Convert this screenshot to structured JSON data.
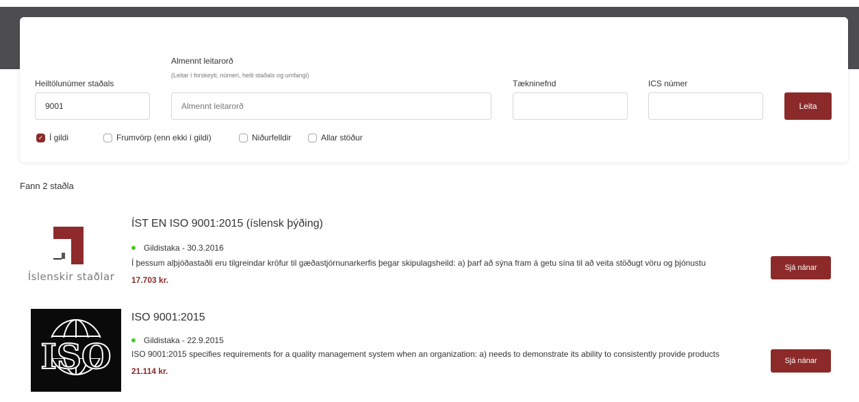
{
  "search": {
    "fields": {
      "number_label": "Heiltölunúmer staðals",
      "number_value": "9001",
      "general_label": "Almennt leitarorð",
      "general_hint": "(Leitar í forskeyti, númeri, heiti staðals og umfangi)",
      "general_placeholder": "Almennt leitarorð",
      "committee_label": "Tækninefnd",
      "committee_value": "",
      "ics_label": "ICS númer",
      "ics_value": ""
    },
    "button_label": "Leita",
    "status_filters": [
      {
        "label": "Í gildi",
        "checked": true
      },
      {
        "label": "Frumvörp (enn ekki í gildi)",
        "checked": false
      },
      {
        "label": "Niðurfelldir",
        "checked": false
      },
      {
        "label": "Allar stöður",
        "checked": false
      }
    ]
  },
  "results": {
    "count_text": "Fann 2 staðla",
    "items": [
      {
        "logo": "islenskir-stadlar-logo",
        "logo_text": "Íslenskir staðlar",
        "title": "ÍST EN ISO 9001:2015 (íslensk þýðing)",
        "status": "Gildistaka - 30.3.2016",
        "description": "Í þessum alþjóðastaðli eru tilgreindar kröfur til gæðastjórnunarkerfis þegar skipulagsheild: a) þarf að sýna fram á getu sína til að veita stöðugt vöru og þjónustu",
        "price": "17.703 kr.",
        "button_label": "Sjá nánar"
      },
      {
        "logo": "iso-logo",
        "logo_text": "ISO",
        "title": "ISO 9001:2015",
        "status": "Gildistaka - 22.9.2015",
        "description": "ISO 9001:2015 specifies requirements for a quality management system when an organization: a) needs to demonstrate its ability to consistently provide products",
        "price": "21.114 kr.",
        "button_label": "Sjá nánar"
      }
    ]
  },
  "colors": {
    "accent": "#8c2a2a",
    "header_band": "#4d4d4f",
    "status_dot": "#44cc22"
  }
}
